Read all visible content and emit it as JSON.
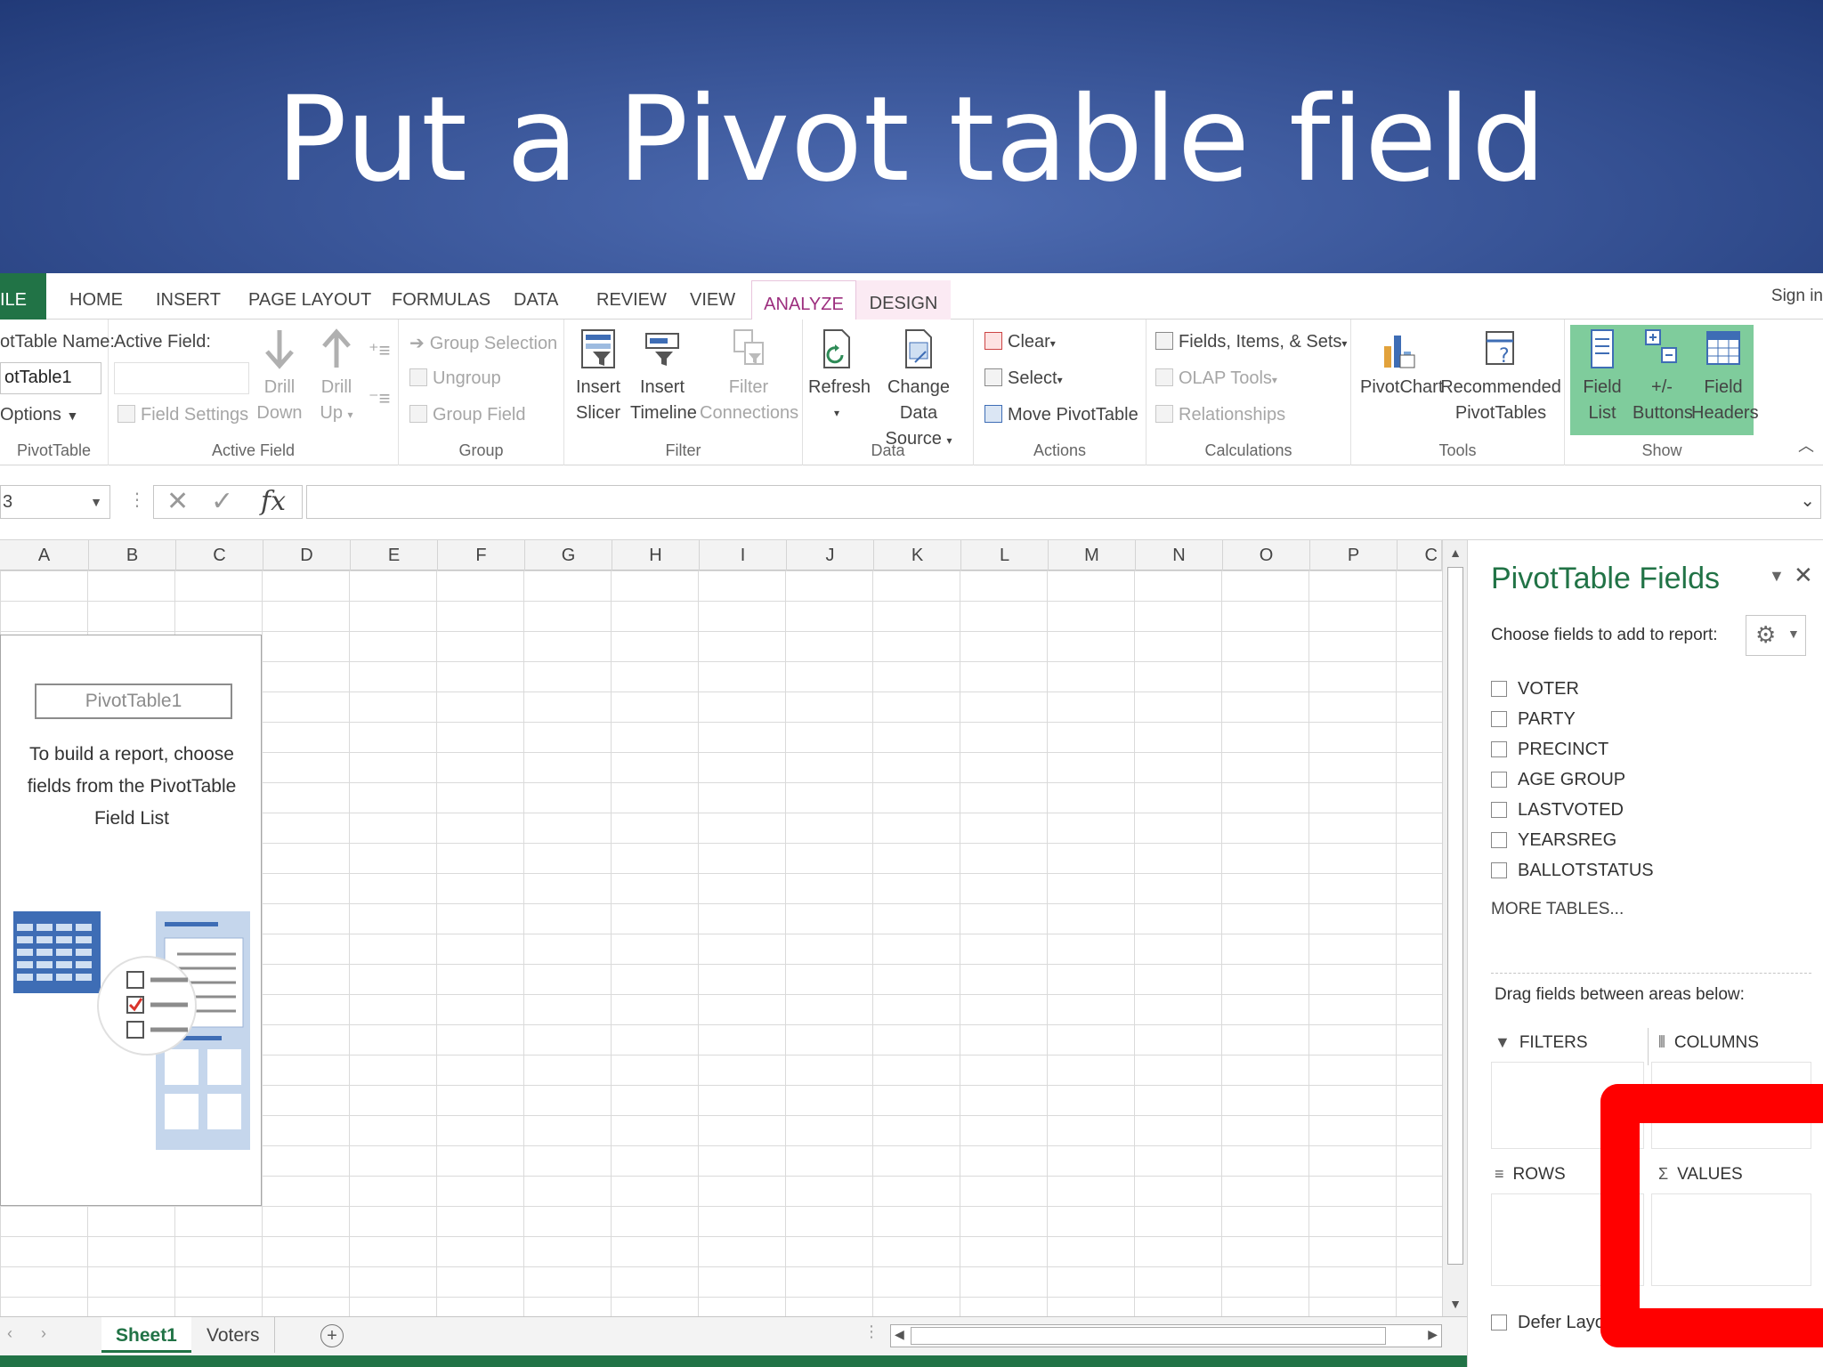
{
  "slide": {
    "title": "Put a Pivot table field"
  },
  "tabs": {
    "file": "ILE",
    "items": [
      "HOME",
      "INSERT",
      "PAGE LAYOUT",
      "FORMULAS",
      "DATA",
      "REVIEW",
      "VIEW"
    ],
    "analyze": "ANALYZE",
    "design": "DESIGN",
    "signin": "Sign in"
  },
  "ribbon": {
    "pivottable": {
      "name_label": "otTable Name:",
      "name_value": "otTable1",
      "options": "Options",
      "group": "PivotTable"
    },
    "active_field": {
      "label": "Active Field:",
      "field_settings": "Field Settings",
      "drill_down": [
        "Drill",
        "Down"
      ],
      "drill_up": [
        "Drill",
        "Up"
      ],
      "group": "Active Field"
    },
    "group": {
      "group_selection": "Group Selection",
      "ungroup": "Ungroup",
      "group_field": "Group Field",
      "group": "Group"
    },
    "filter": {
      "insert_slicer": [
        "Insert",
        "Slicer"
      ],
      "insert_timeline": [
        "Insert",
        "Timeline"
      ],
      "filter_connections": [
        "Filter",
        "Connections"
      ],
      "group": "Filter"
    },
    "data": {
      "refresh": "Refresh",
      "change_data_source": [
        "Change Data",
        "Source"
      ],
      "group": "Data"
    },
    "actions": {
      "clear": "Clear",
      "select": "Select",
      "move": "Move PivotTable",
      "group": "Actions"
    },
    "calculations": {
      "fields_items_sets": "Fields, Items, & Sets",
      "olap_tools": "OLAP Tools",
      "relationships": "Relationships",
      "group": "Calculations"
    },
    "tools": {
      "pivotchart": "PivotChart",
      "recommended": [
        "Recommended",
        "PivotTables"
      ],
      "group": "Tools"
    },
    "show": {
      "field_list": [
        "Field",
        "List"
      ],
      "buttons": [
        "+/-",
        "Buttons"
      ],
      "field_headers": [
        "Field",
        "Headers"
      ],
      "group": "Show"
    }
  },
  "formula_bar": {
    "name_box": "3",
    "fx": "fx"
  },
  "grid": {
    "columns": [
      "A",
      "B",
      "C",
      "D",
      "E",
      "F",
      "G",
      "H",
      "I",
      "J",
      "K",
      "L",
      "M",
      "N",
      "O",
      "P",
      "C"
    ]
  },
  "placeholder": {
    "name": "PivotTable1",
    "message": "To build a report, choose fields from the PivotTable Field List"
  },
  "sheets": {
    "tabs": [
      "Sheet1",
      "Voters"
    ],
    "active": "Sheet1"
  },
  "pane": {
    "title": "PivotTable Fields",
    "choose": "Choose fields to add to report:",
    "fields": [
      "VOTER",
      "PARTY",
      "PRECINCT",
      "AGE GROUP",
      "LASTVOTED",
      "YEARSREG",
      "BALLOTSTATUS"
    ],
    "more_tables": "MORE TABLES...",
    "drag_label": "Drag fields between areas below:",
    "areas": {
      "filters": "FILTERS",
      "columns": "COLUMNS",
      "rows": "ROWS",
      "values": "VALUES"
    },
    "defer": "Defer Layou"
  },
  "colors": {
    "excel_green": "#217346",
    "analyze_accent": "#9c2e7e",
    "highlight": "#ff0000",
    "banner": "#3a5699"
  }
}
